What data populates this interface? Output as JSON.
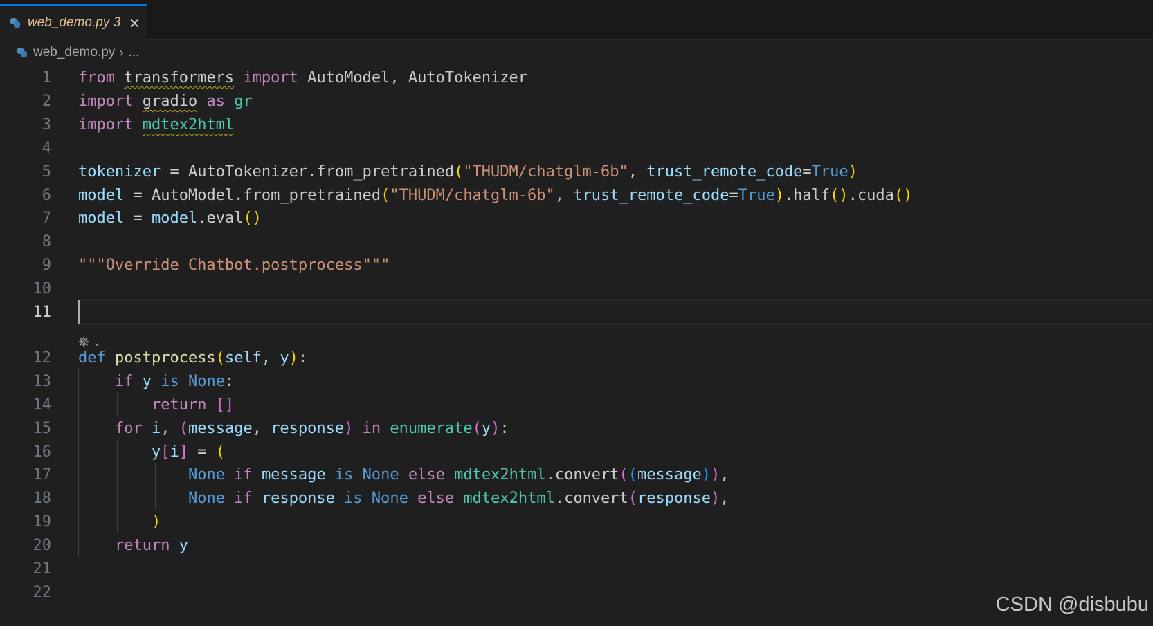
{
  "tab": {
    "filename": "web_demo.py",
    "problem_count": "3",
    "close_icon": "×",
    "label_color": "#e2c08d"
  },
  "breadcrumb": {
    "file": "web_demo.py",
    "separator": "›",
    "more": "..."
  },
  "editor": {
    "active_line": 11,
    "ai_sparkle_icon": "✵",
    "ai_chevron_icon": "⌄",
    "lines": [
      {
        "n": "1",
        "t": [
          [
            "from ",
            "#c586c0"
          ],
          [
            "transformers",
            "#cccccc",
            "sq"
          ],
          [
            " ",
            "#cccccc"
          ],
          [
            "import",
            "#c586c0"
          ],
          [
            " AutoModel, AutoTokenizer",
            "#cccccc"
          ]
        ]
      },
      {
        "n": "2",
        "t": [
          [
            "import ",
            "#c586c0"
          ],
          [
            "gradio",
            "#cccccc",
            "sq"
          ],
          [
            " ",
            "#cccccc"
          ],
          [
            "as",
            "#c586c0"
          ],
          [
            " ",
            "#cccccc"
          ],
          [
            "gr",
            "#4ec9b0"
          ]
        ]
      },
      {
        "n": "3",
        "t": [
          [
            "import ",
            "#c586c0"
          ],
          [
            "mdtex2html",
            "#4ec9b0",
            "sq"
          ]
        ]
      },
      {
        "n": "4",
        "t": []
      },
      {
        "n": "5",
        "t": [
          [
            "tokenizer",
            "#9cdcfe"
          ],
          [
            " = AutoTokenizer.from_pretrained",
            "#cccccc"
          ],
          [
            "(",
            "#ffd700"
          ],
          [
            "\"THUDM/chatglm-6b\"",
            "#ce9178"
          ],
          [
            ", ",
            "#cccccc"
          ],
          [
            "trust_remote_code",
            "#9cdcfe"
          ],
          [
            "=",
            "#cccccc"
          ],
          [
            "True",
            "#569cd6"
          ],
          [
            ")",
            "#ffd700"
          ]
        ]
      },
      {
        "n": "6",
        "t": [
          [
            "model",
            "#9cdcfe"
          ],
          [
            " = AutoModel.from_pretrained",
            "#cccccc"
          ],
          [
            "(",
            "#ffd700"
          ],
          [
            "\"THUDM/chatglm-6b\"",
            "#ce9178"
          ],
          [
            ", ",
            "#cccccc"
          ],
          [
            "trust_remote_code",
            "#9cdcfe"
          ],
          [
            "=",
            "#cccccc"
          ],
          [
            "True",
            "#569cd6"
          ],
          [
            ")",
            "#ffd700"
          ],
          [
            ".half",
            "#cccccc"
          ],
          [
            "()",
            "#ffd700"
          ],
          [
            ".cuda",
            "#cccccc"
          ],
          [
            "()",
            "#ffd700"
          ]
        ]
      },
      {
        "n": "7",
        "t": [
          [
            "model",
            "#9cdcfe"
          ],
          [
            " = ",
            "#cccccc"
          ],
          [
            "model",
            "#9cdcfe"
          ],
          [
            ".eval",
            "#cccccc"
          ],
          [
            "()",
            "#ffd700"
          ]
        ]
      },
      {
        "n": "8",
        "t": []
      },
      {
        "n": "9",
        "t": [
          [
            "\"\"\"Override Chatbot.postprocess\"\"\"",
            "#ce9178"
          ]
        ]
      },
      {
        "n": "10",
        "t": []
      },
      {
        "n": "11",
        "t": []
      },
      {
        "n": "12",
        "t": [
          [
            "def ",
            "#569cd6"
          ],
          [
            "postprocess",
            "#dcdcaa"
          ],
          [
            "(",
            "#ffd700"
          ],
          [
            "self",
            "#9cdcfe"
          ],
          [
            ", ",
            "#cccccc"
          ],
          [
            "y",
            "#9cdcfe"
          ],
          [
            ")",
            "#ffd700"
          ],
          [
            ":",
            "#cccccc"
          ]
        ]
      },
      {
        "n": "13",
        "t": [
          [
            "    ",
            "#cccccc"
          ],
          [
            "if ",
            "#c586c0"
          ],
          [
            "y",
            "#9cdcfe"
          ],
          [
            " ",
            "#cccccc"
          ],
          [
            "is",
            "#569cd6"
          ],
          [
            " ",
            "#cccccc"
          ],
          [
            "None",
            "#569cd6"
          ],
          [
            ":",
            "#cccccc"
          ]
        ]
      },
      {
        "n": "14",
        "t": [
          [
            "        ",
            "#cccccc"
          ],
          [
            "return ",
            "#c586c0"
          ],
          [
            "[]",
            "#da70d6"
          ]
        ]
      },
      {
        "n": "15",
        "t": [
          [
            "    ",
            "#cccccc"
          ],
          [
            "for ",
            "#c586c0"
          ],
          [
            "i",
            "#9cdcfe"
          ],
          [
            ", ",
            "#cccccc"
          ],
          [
            "(",
            "#da70d6"
          ],
          [
            "message",
            "#9cdcfe"
          ],
          [
            ", ",
            "#cccccc"
          ],
          [
            "response",
            "#9cdcfe"
          ],
          [
            ")",
            "#da70d6"
          ],
          [
            " ",
            "#cccccc"
          ],
          [
            "in",
            "#c586c0"
          ],
          [
            " ",
            "#cccccc"
          ],
          [
            "enumerate",
            "#4ec9b0"
          ],
          [
            "(",
            "#da70d6"
          ],
          [
            "y",
            "#9cdcfe"
          ],
          [
            ")",
            "#da70d6"
          ],
          [
            ":",
            "#cccccc"
          ]
        ]
      },
      {
        "n": "16",
        "t": [
          [
            "        ",
            "#cccccc"
          ],
          [
            "y",
            "#9cdcfe"
          ],
          [
            "[",
            "#da70d6"
          ],
          [
            "i",
            "#9cdcfe"
          ],
          [
            "]",
            "#da70d6"
          ],
          [
            " = ",
            "#cccccc"
          ],
          [
            "(",
            "#ffd700"
          ]
        ]
      },
      {
        "n": "17",
        "t": [
          [
            "            ",
            "#cccccc"
          ],
          [
            "None",
            "#569cd6"
          ],
          [
            " ",
            "#cccccc"
          ],
          [
            "if",
            "#c586c0"
          ],
          [
            " ",
            "#cccccc"
          ],
          [
            "message",
            "#9cdcfe"
          ],
          [
            " ",
            "#cccccc"
          ],
          [
            "is",
            "#569cd6"
          ],
          [
            " ",
            "#cccccc"
          ],
          [
            "None",
            "#569cd6"
          ],
          [
            " ",
            "#cccccc"
          ],
          [
            "else",
            "#c586c0"
          ],
          [
            " ",
            "#cccccc"
          ],
          [
            "mdtex2html",
            "#4ec9b0"
          ],
          [
            ".convert",
            "#cccccc"
          ],
          [
            "(",
            "#da70d6"
          ],
          [
            "(",
            "#179fff"
          ],
          [
            "message",
            "#9cdcfe"
          ],
          [
            ")",
            "#179fff"
          ],
          [
            ")",
            "#da70d6"
          ],
          [
            ",",
            "#cccccc"
          ]
        ]
      },
      {
        "n": "18",
        "t": [
          [
            "            ",
            "#cccccc"
          ],
          [
            "None",
            "#569cd6"
          ],
          [
            " ",
            "#cccccc"
          ],
          [
            "if",
            "#c586c0"
          ],
          [
            " ",
            "#cccccc"
          ],
          [
            "response",
            "#9cdcfe"
          ],
          [
            " ",
            "#cccccc"
          ],
          [
            "is",
            "#569cd6"
          ],
          [
            " ",
            "#cccccc"
          ],
          [
            "None",
            "#569cd6"
          ],
          [
            " ",
            "#cccccc"
          ],
          [
            "else",
            "#c586c0"
          ],
          [
            " ",
            "#cccccc"
          ],
          [
            "mdtex2html",
            "#4ec9b0"
          ],
          [
            ".convert",
            "#cccccc"
          ],
          [
            "(",
            "#da70d6"
          ],
          [
            "response",
            "#9cdcfe"
          ],
          [
            ")",
            "#da70d6"
          ],
          [
            ",",
            "#cccccc"
          ]
        ]
      },
      {
        "n": "19",
        "t": [
          [
            "        ",
            "#cccccc"
          ],
          [
            ")",
            "#ffd700"
          ]
        ]
      },
      {
        "n": "20",
        "t": [
          [
            "    ",
            "#cccccc"
          ],
          [
            "return ",
            "#c586c0"
          ],
          [
            "y",
            "#9cdcfe"
          ]
        ]
      },
      {
        "n": "21",
        "t": []
      },
      {
        "n": "22",
        "t": []
      }
    ]
  },
  "watermark": "CSDN @disbubu"
}
